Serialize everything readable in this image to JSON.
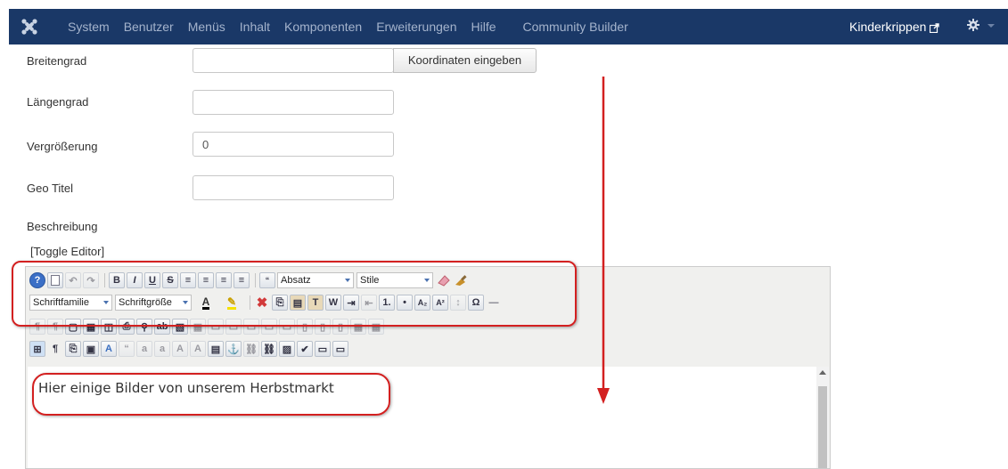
{
  "topbar": {
    "menu": [
      "System",
      "Benutzer",
      "Menüs",
      "Inhalt",
      "Komponenten",
      "Erweiterungen",
      "Hilfe",
      "Community Builder"
    ],
    "site_link": "Kinderkrippen"
  },
  "form": {
    "latitude_label": "Breitengrad",
    "latitude_value": "",
    "coord_button": "Koordinaten eingeben",
    "longitude_label": "Längengrad",
    "longitude_value": "",
    "zoom_label": "Vergrößerung",
    "zoom_value": "0",
    "geo_title_label": "Geo Titel",
    "geo_title_value": "",
    "description_label": "Beschreibung",
    "toggle_editor": "[Toggle Editor]"
  },
  "editor": {
    "format_select": "Absatz",
    "style_select": "Stile",
    "font_family_select": "Schriftfamilie",
    "font_size_select": "Schriftgröße",
    "content": "Hier einige Bilder von unserem Herbstmarkt"
  },
  "colors": {
    "topbar": "#1a3867",
    "annotation": "#d32020"
  }
}
